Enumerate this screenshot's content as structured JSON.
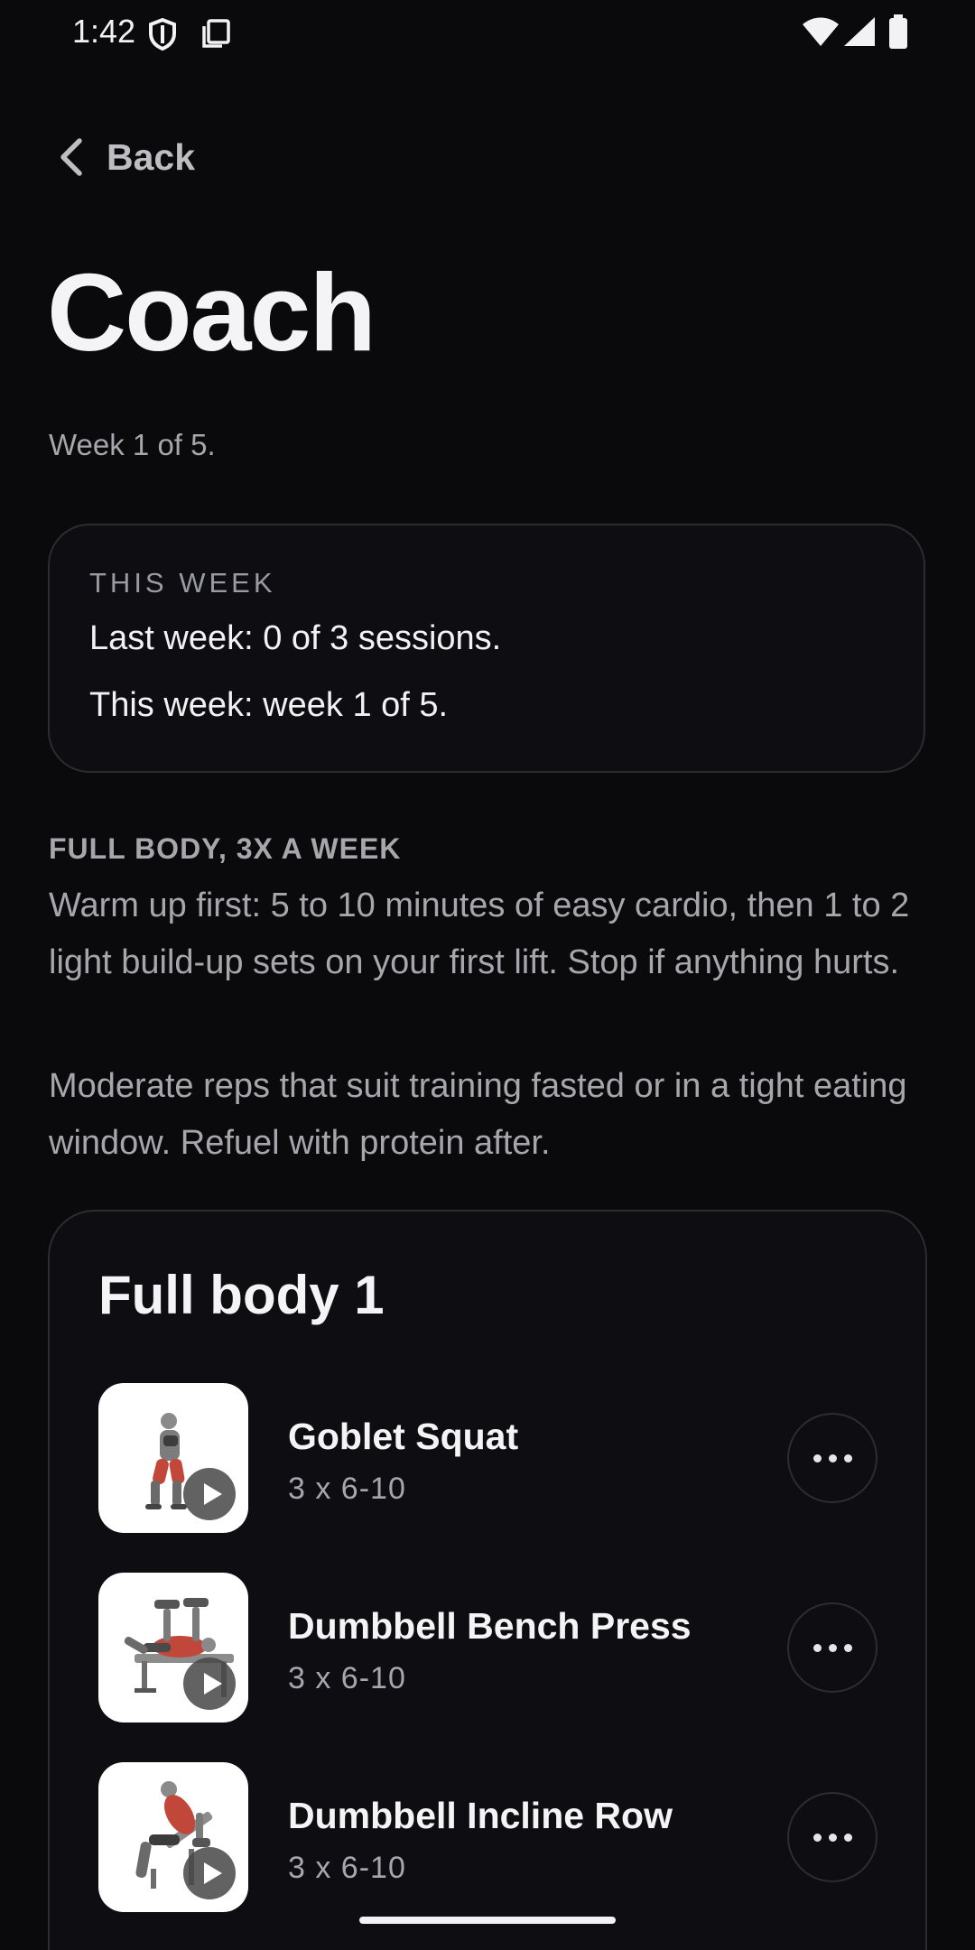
{
  "status_bar": {
    "time": "1:42",
    "icons": [
      "shield-icon",
      "copy-icon",
      "wifi-icon",
      "signal-icon",
      "battery-icon"
    ]
  },
  "nav": {
    "back_label": "Back",
    "back_icon": "chevron-left-icon"
  },
  "header": {
    "title": "Coach",
    "subtitle": "Week 1 of 5."
  },
  "this_week_card": {
    "heading": "THIS WEEK",
    "last_week": "Last week: 0 of 3 sessions.",
    "this_week": "This week: week 1 of 5."
  },
  "plan": {
    "heading": "FULL BODY, 3X A WEEK",
    "warmup": "Warm up first: 5 to 10 minutes of easy cardio, then 1 to 2 light build-up sets on your first lift. Stop if anything hurts.",
    "note": "Moderate reps that suit training fasted or in a tight eating window. Refuel with protein after."
  },
  "workout": {
    "title": "Full body 1",
    "exercises": [
      {
        "name": "Goblet Squat",
        "sets": "3 x 6-10",
        "icon": "play-icon"
      },
      {
        "name": "Dumbbell Bench Press",
        "sets": "3 x 6-10",
        "icon": "play-icon"
      },
      {
        "name": "Dumbbell Incline Row",
        "sets": "3 x 6-10",
        "icon": "play-icon"
      }
    ],
    "more_icon": "more-horizontal-icon"
  },
  "colors": {
    "background": "#0a0a0c",
    "card": "#0e0e12",
    "card_border": "#2c2c31",
    "text_primary": "#f4f4f6",
    "text_secondary": "#a6a6ac"
  }
}
